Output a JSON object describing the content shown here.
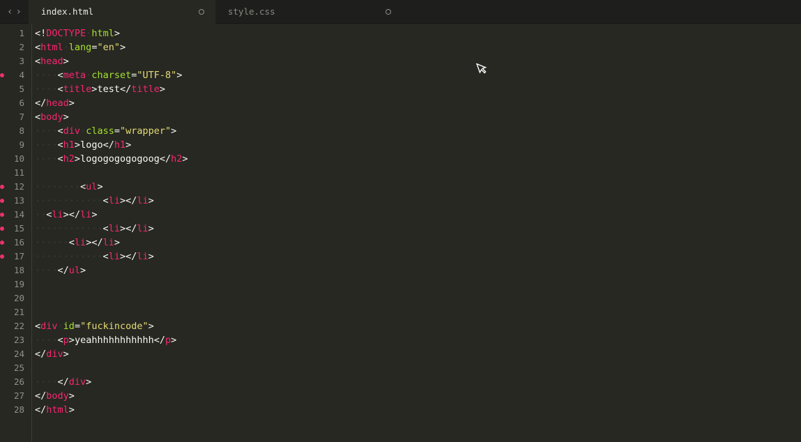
{
  "tabs": [
    {
      "label": "index.html",
      "active": true,
      "dirty": true
    },
    {
      "label": "style.css",
      "active": false,
      "dirty": true
    }
  ],
  "lines": [
    {
      "num": 1,
      "modified": false,
      "tokens": [
        [
          "punct",
          "<!"
        ],
        [
          "tag",
          "DOCTYPE"
        ],
        [
          "ws",
          " "
        ],
        [
          "attr",
          "html"
        ],
        [
          "punct",
          ">"
        ]
      ]
    },
    {
      "num": 2,
      "modified": false,
      "tokens": [
        [
          "punct",
          "<"
        ],
        [
          "tag",
          "html"
        ],
        [
          "ws",
          " "
        ],
        [
          "attr",
          "lang"
        ],
        [
          "punct",
          "="
        ],
        [
          "string",
          "\"en\""
        ],
        [
          "punct",
          ">"
        ]
      ]
    },
    {
      "num": 3,
      "modified": false,
      "tokens": [
        [
          "punct",
          "<"
        ],
        [
          "tag",
          "head"
        ],
        [
          "punct",
          ">"
        ]
      ]
    },
    {
      "num": 4,
      "modified": true,
      "tokens": [
        [
          "indent",
          4
        ],
        [
          "punct",
          "<"
        ],
        [
          "tag",
          "meta"
        ],
        [
          "ws",
          " "
        ],
        [
          "attr",
          "charset"
        ],
        [
          "punct",
          "="
        ],
        [
          "string",
          "\"UTF-8\""
        ],
        [
          "punct",
          ">"
        ]
      ]
    },
    {
      "num": 5,
      "modified": false,
      "tokens": [
        [
          "indent",
          4
        ],
        [
          "punct",
          "<"
        ],
        [
          "tag",
          "title"
        ],
        [
          "punct",
          ">"
        ],
        [
          "text",
          "test"
        ],
        [
          "punct",
          "</"
        ],
        [
          "tag",
          "title"
        ],
        [
          "punct",
          ">"
        ]
      ]
    },
    {
      "num": 6,
      "modified": false,
      "tokens": [
        [
          "punct",
          "</"
        ],
        [
          "tag",
          "head"
        ],
        [
          "punct",
          ">"
        ]
      ]
    },
    {
      "num": 7,
      "modified": false,
      "tokens": [
        [
          "punct",
          "<"
        ],
        [
          "tag",
          "body"
        ],
        [
          "punct",
          ">"
        ]
      ]
    },
    {
      "num": 8,
      "modified": false,
      "tokens": [
        [
          "indent",
          4
        ],
        [
          "punct",
          "<"
        ],
        [
          "tag",
          "div"
        ],
        [
          "ws",
          " "
        ],
        [
          "attr",
          "class"
        ],
        [
          "punct",
          "="
        ],
        [
          "string",
          "\"wrapper\""
        ],
        [
          "punct",
          ">"
        ]
      ]
    },
    {
      "num": 9,
      "modified": false,
      "tokens": [
        [
          "indent",
          4
        ],
        [
          "punct",
          "<"
        ],
        [
          "tag",
          "h1"
        ],
        [
          "punct",
          ">"
        ],
        [
          "text",
          "logo"
        ],
        [
          "punct",
          "</"
        ],
        [
          "tag",
          "h1"
        ],
        [
          "punct",
          ">"
        ]
      ]
    },
    {
      "num": 10,
      "modified": false,
      "tokens": [
        [
          "indent",
          4
        ],
        [
          "punct",
          "<"
        ],
        [
          "tag",
          "h2"
        ],
        [
          "punct",
          ">"
        ],
        [
          "text",
          "logogogogogoog"
        ],
        [
          "punct",
          "</"
        ],
        [
          "tag",
          "h2"
        ],
        [
          "punct",
          ">"
        ]
      ]
    },
    {
      "num": 11,
      "modified": false,
      "tokens": []
    },
    {
      "num": 12,
      "modified": true,
      "tokens": [
        [
          "indent",
          8
        ],
        [
          "punct",
          "<"
        ],
        [
          "tag",
          "ul"
        ],
        [
          "punct",
          ">"
        ]
      ]
    },
    {
      "num": 13,
      "modified": true,
      "tokens": [
        [
          "indent",
          12
        ],
        [
          "punct",
          "<"
        ],
        [
          "tag",
          "li"
        ],
        [
          "punct",
          ">"
        ],
        [
          "punct",
          "</"
        ],
        [
          "tag",
          "li"
        ],
        [
          "punct",
          ">"
        ]
      ]
    },
    {
      "num": 14,
      "modified": true,
      "tokens": [
        [
          "indent",
          2
        ],
        [
          "punct",
          "<"
        ],
        [
          "tag",
          "li"
        ],
        [
          "punct",
          ">"
        ],
        [
          "punct",
          "</"
        ],
        [
          "tag",
          "li"
        ],
        [
          "punct",
          ">"
        ]
      ]
    },
    {
      "num": 15,
      "modified": true,
      "tokens": [
        [
          "indent",
          12
        ],
        [
          "punct",
          "<"
        ],
        [
          "tag",
          "li"
        ],
        [
          "punct",
          ">"
        ],
        [
          "punct",
          "</"
        ],
        [
          "tag",
          "li"
        ],
        [
          "punct",
          ">"
        ]
      ]
    },
    {
      "num": 16,
      "modified": true,
      "tokens": [
        [
          "indent",
          6
        ],
        [
          "punct",
          "<"
        ],
        [
          "tag",
          "li"
        ],
        [
          "punct",
          ">"
        ],
        [
          "punct",
          "</"
        ],
        [
          "tag",
          "li"
        ],
        [
          "punct",
          ">"
        ]
      ]
    },
    {
      "num": 17,
      "modified": true,
      "tokens": [
        [
          "indent",
          12
        ],
        [
          "punct",
          "<"
        ],
        [
          "tag",
          "li"
        ],
        [
          "punct",
          ">"
        ],
        [
          "punct",
          "</"
        ],
        [
          "tag",
          "li"
        ],
        [
          "punct",
          ">"
        ]
      ]
    },
    {
      "num": 18,
      "modified": false,
      "tokens": [
        [
          "indent",
          4
        ],
        [
          "punct",
          "</"
        ],
        [
          "tag",
          "ul"
        ],
        [
          "punct",
          ">"
        ]
      ]
    },
    {
      "num": 19,
      "modified": false,
      "tokens": []
    },
    {
      "num": 20,
      "modified": false,
      "tokens": []
    },
    {
      "num": 21,
      "modified": false,
      "tokens": []
    },
    {
      "num": 22,
      "modified": false,
      "tokens": [
        [
          "punct",
          "<"
        ],
        [
          "tag",
          "div"
        ],
        [
          "ws",
          " "
        ],
        [
          "attr",
          "id"
        ],
        [
          "punct",
          "="
        ],
        [
          "string",
          "\"fuckincode\""
        ],
        [
          "punct",
          ">"
        ]
      ]
    },
    {
      "num": 23,
      "modified": false,
      "tokens": [
        [
          "indent",
          4
        ],
        [
          "punct",
          "<"
        ],
        [
          "tag",
          "p"
        ],
        [
          "punct",
          ">"
        ],
        [
          "text",
          "yeahhhhhhhhhhh"
        ],
        [
          "punct",
          "</"
        ],
        [
          "tag",
          "p"
        ],
        [
          "punct",
          ">"
        ]
      ]
    },
    {
      "num": 24,
      "modified": false,
      "tokens": [
        [
          "punct",
          "</"
        ],
        [
          "tag",
          "div"
        ],
        [
          "punct",
          ">"
        ]
      ]
    },
    {
      "num": 25,
      "modified": false,
      "tokens": []
    },
    {
      "num": 26,
      "modified": false,
      "tokens": [
        [
          "indent",
          4
        ],
        [
          "punct",
          "</"
        ],
        [
          "tag",
          "div"
        ],
        [
          "punct",
          ">"
        ]
      ]
    },
    {
      "num": 27,
      "modified": false,
      "tokens": [
        [
          "punct",
          "</"
        ],
        [
          "tag",
          "body"
        ],
        [
          "punct",
          ">"
        ]
      ]
    },
    {
      "num": 28,
      "modified": false,
      "tokens": [
        [
          "punct",
          "</"
        ],
        [
          "tag",
          "html"
        ],
        [
          "punct",
          ">"
        ]
      ]
    }
  ]
}
